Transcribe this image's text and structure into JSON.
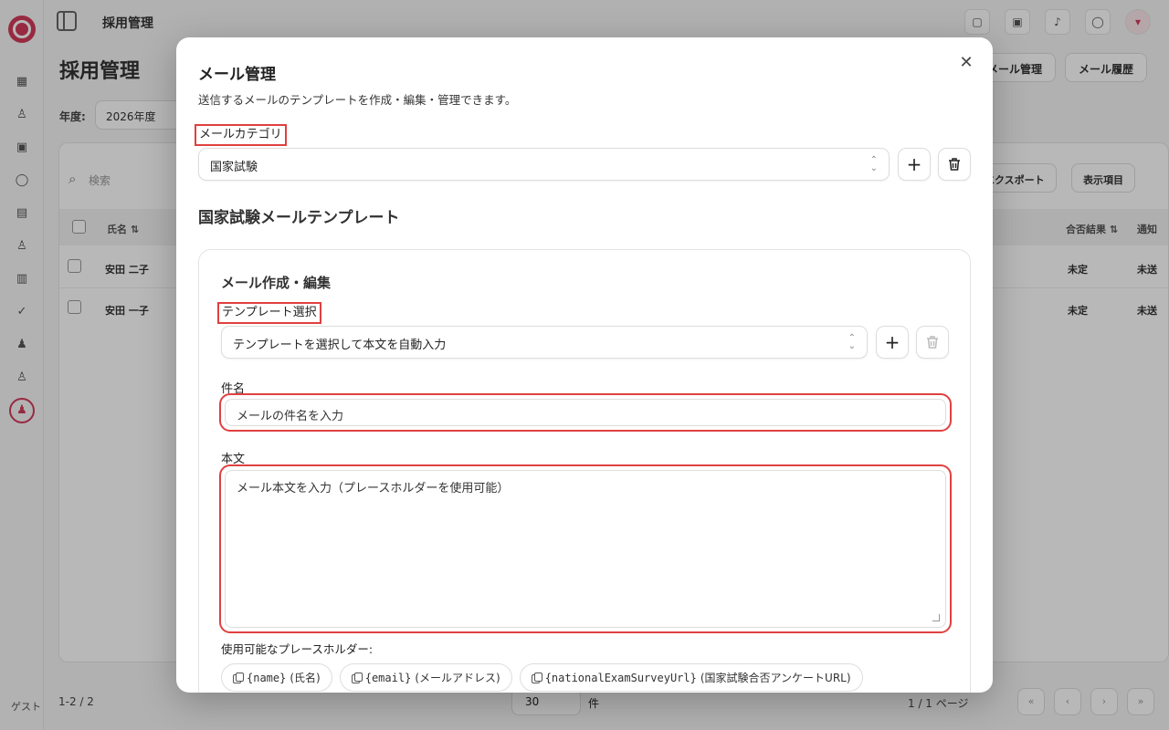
{
  "app": {
    "top_title": "採用管理",
    "page_title": "採用管理",
    "user_chip": "ゲスト",
    "year_label": "年度:",
    "year_value": "2026年度",
    "header_buttons": [
      "メール管理",
      "メール履歴"
    ],
    "search_placeholder": "検索",
    "table_buttons": [
      "エクスポート",
      "表示項目"
    ],
    "columns": [
      "氏名 ⇅",
      "合否結果 ⇅",
      "通知"
    ],
    "rows": [
      {
        "name": "安田 二子",
        "result": "未定",
        "notify": "未送"
      },
      {
        "name": "安田 一子",
        "result": "未定",
        "notify": "未送"
      }
    ],
    "footer_count": "1-2 / 2",
    "page_size": "30",
    "page_size_unit": "件",
    "page_info": "1 / 1 ページ"
  },
  "modal": {
    "title": "メール管理",
    "description": "送信するメールのテンプレートを作成・編集・管理できます。",
    "category_label": "メールカテゴリ",
    "category_value": "国家試験",
    "section_title": "国家試験メールテンプレート",
    "editor": {
      "title": "メール作成・編集",
      "template_label": "テンプレート選択",
      "template_placeholder": "テンプレートを選択して本文を自動入力",
      "subject_label": "件名",
      "subject_placeholder": "メールの件名を入力",
      "body_label": "本文",
      "body_placeholder": "メール本文を入力（プレースホルダーを使用可能）",
      "placeholders_label": "使用可能なプレースホルダー:",
      "placeholders": [
        {
          "code": "{name}",
          "desc": "(氏名)"
        },
        {
          "code": "{email}",
          "desc": "(メールアドレス)"
        },
        {
          "code": "{nationalExamSurveyUrl}",
          "desc": "(国家試験合否アンケートURL)"
        }
      ]
    }
  },
  "colors": {
    "accent": "#d23b5a",
    "highlight": "#e04040"
  }
}
